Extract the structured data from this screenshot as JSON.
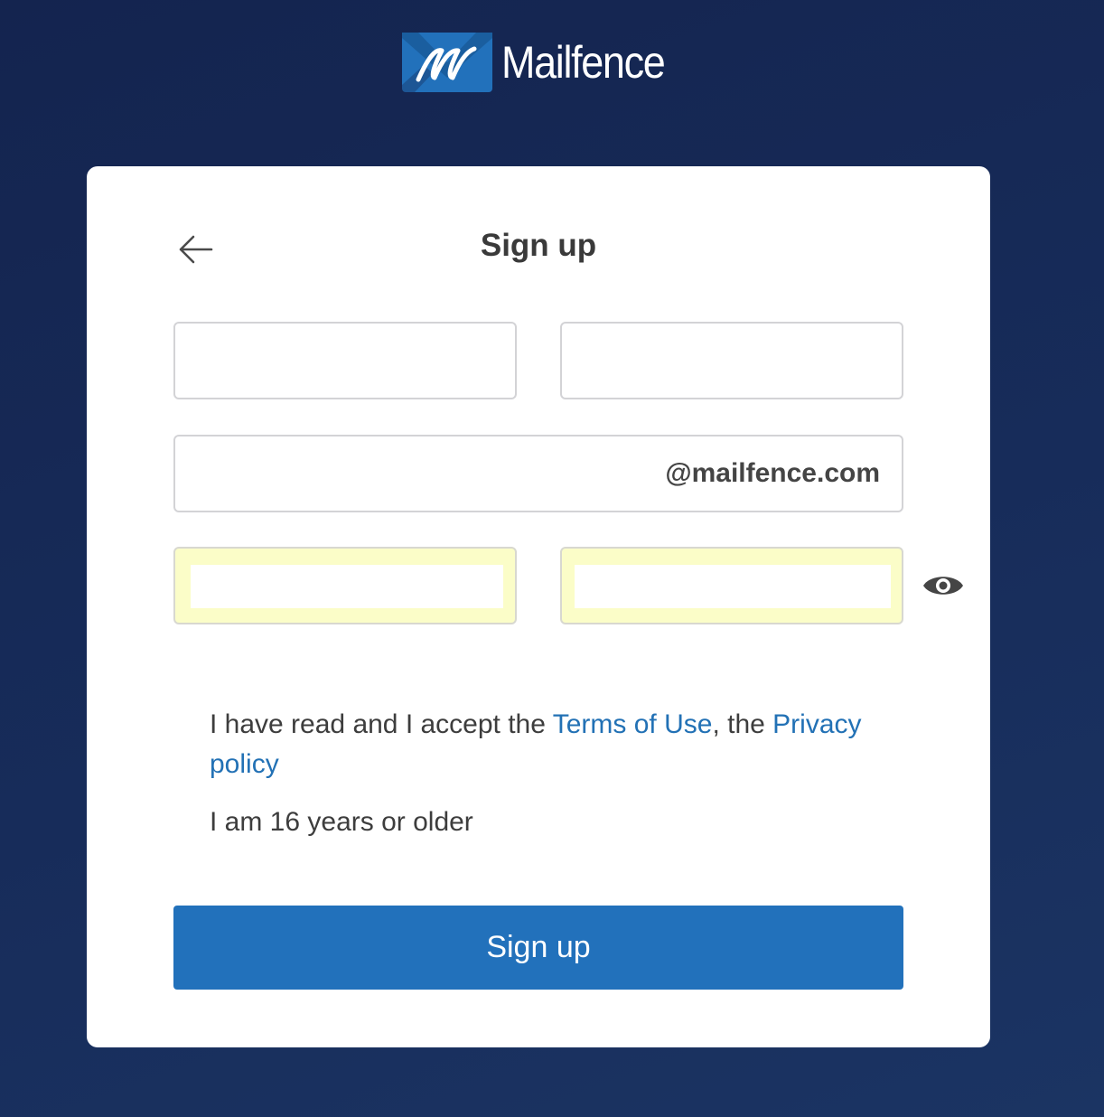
{
  "brand": {
    "name": "Mailfence",
    "accent_color": "#2271bb",
    "logo_icon": "mailfence-logo-icon"
  },
  "signup": {
    "title": "Sign up",
    "back_icon": "arrow-left-icon",
    "fields": {
      "first_name": {
        "value": "",
        "placeholder": ""
      },
      "last_name": {
        "value": "",
        "placeholder": ""
      },
      "username": {
        "value": "",
        "placeholder": "",
        "suffix": "@mailfence.com"
      },
      "password": {
        "value": "",
        "placeholder": ""
      },
      "password_confirm": {
        "value": "",
        "placeholder": ""
      }
    },
    "show_password_icon": "eye-icon",
    "terms": {
      "prefix": "I have read and I accept the ",
      "terms_link": "Terms of Use",
      "middle": ", the ",
      "privacy_link": "Privacy policy"
    },
    "age_statement": "I am 16 years or older",
    "submit_label": "Sign up"
  }
}
